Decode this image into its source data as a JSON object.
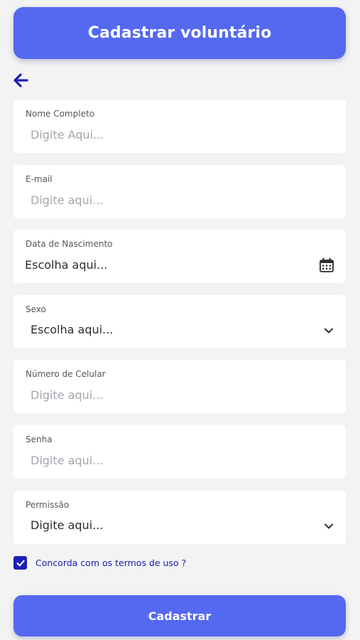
{
  "header": {
    "title": "Cadastrar voluntário"
  },
  "fields": {
    "nome": {
      "label": "Nome Completo",
      "placeholder": "Digite Aqui..."
    },
    "email": {
      "label": "E-mail",
      "placeholder": "Digite aqui..."
    },
    "nascimento": {
      "label": "Data de Nascimento",
      "placeholder": "Escolha aqui..."
    },
    "sexo": {
      "label": "Sexo",
      "value": "Escolha aqui..."
    },
    "celular": {
      "label": "Número de Celular",
      "placeholder": "Digite aqui..."
    },
    "senha": {
      "label": "Senha",
      "placeholder": "Digite aqui..."
    },
    "permissao": {
      "label": "Permissão",
      "value": "Digite aqui..."
    }
  },
  "terms": {
    "label": "Concorda com os termos de uso ?",
    "checked": true
  },
  "submit": {
    "label": "Cadastrar"
  },
  "colors": {
    "primary": "#5468f0",
    "accent": "#1b1fb4",
    "background": "#f3f3f4"
  }
}
